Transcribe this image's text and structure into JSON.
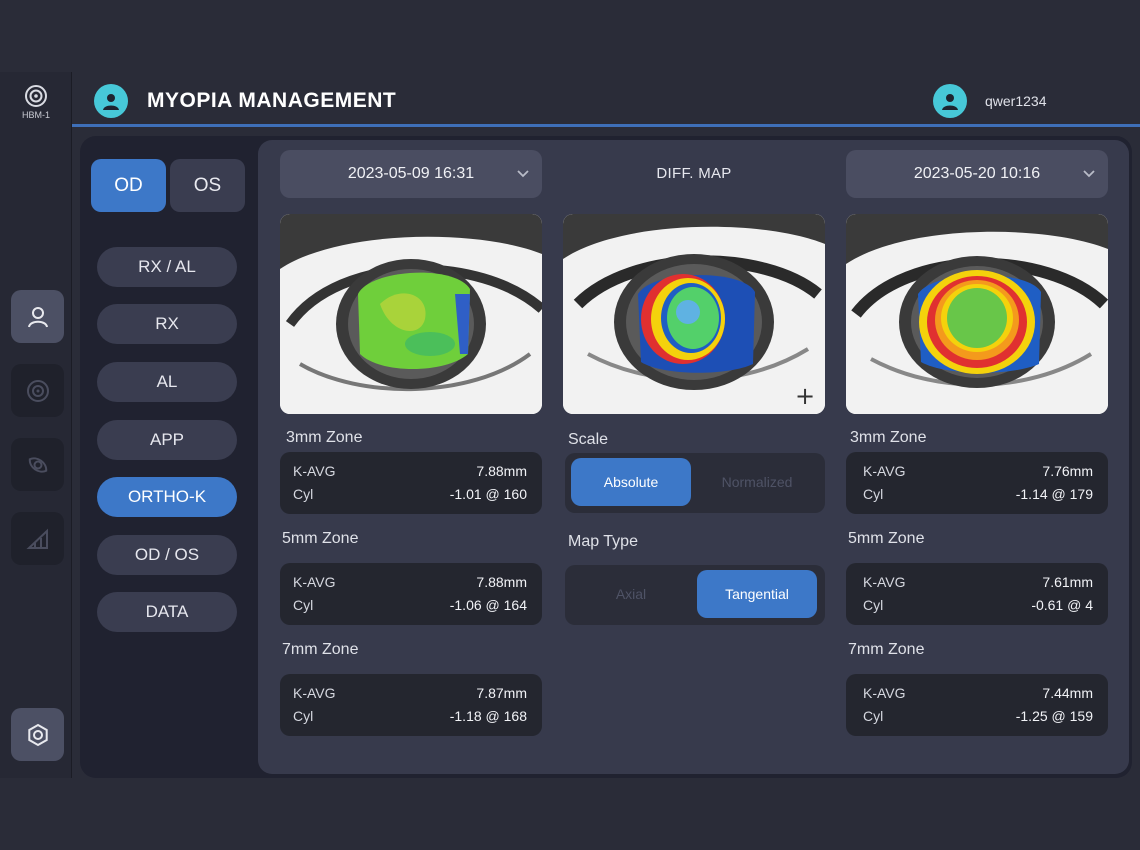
{
  "device": {
    "label": "HBM-1",
    "icon": "lens-icon"
  },
  "header": {
    "title": "MYOPIA MANAGEMENT",
    "username": "qwer1234"
  },
  "nav_rail": [
    {
      "name": "user-icon",
      "active": true
    },
    {
      "name": "target-icon",
      "active": false
    },
    {
      "name": "eye-scan-icon",
      "active": false
    },
    {
      "name": "chart-icon",
      "active": false
    },
    {
      "name": "settings-gear-icon",
      "active": false
    }
  ],
  "eye_toggle": {
    "od": "OD",
    "os": "OS",
    "selected": "OD"
  },
  "menu": [
    {
      "label": "RX / AL",
      "active": false
    },
    {
      "label": "RX",
      "active": false
    },
    {
      "label": "AL",
      "active": false
    },
    {
      "label": "APP",
      "active": false
    },
    {
      "label": "ORTHO-K",
      "active": true
    },
    {
      "label": "OD / OS",
      "active": false
    },
    {
      "label": "DATA",
      "active": false
    }
  ],
  "left_exam": {
    "date": "2023-05-09 16:31",
    "zones": [
      {
        "title": "3mm Zone",
        "kavg_label": "K-AVG",
        "kavg": "7.88mm",
        "cyl_label": "Cyl",
        "cyl": "-1.01 @ 160"
      },
      {
        "title": "5mm Zone",
        "kavg_label": "K-AVG",
        "kavg": "7.88mm",
        "cyl_label": "Cyl",
        "cyl": "-1.06 @ 164"
      },
      {
        "title": "7mm Zone",
        "kavg_label": "K-AVG",
        "kavg": "7.87mm",
        "cyl_label": "Cyl",
        "cyl": "-1.18 @ 168"
      }
    ]
  },
  "diff_map": {
    "label": "DIFF. MAP",
    "scale_title": "Scale",
    "scale_options": [
      "Absolute",
      "Normalized"
    ],
    "scale_selected": "Absolute",
    "map_type_title": "Map Type",
    "map_type_options": [
      "Axial",
      "Tangential"
    ],
    "map_type_selected": "Tangential"
  },
  "right_exam": {
    "date": "2023-05-20 10:16",
    "zones": [
      {
        "title": "3mm Zone",
        "kavg_label": "K-AVG",
        "kavg": "7.76mm",
        "cyl_label": "Cyl",
        "cyl": "-1.14 @ 179"
      },
      {
        "title": "5mm Zone",
        "kavg_label": "K-AVG",
        "kavg": "7.61mm",
        "cyl_label": "Cyl",
        "cyl": "-0.61 @ 4"
      },
      {
        "title": "7mm Zone",
        "kavg_label": "K-AVG",
        "kavg": "7.44mm",
        "cyl_label": "Cyl",
        "cyl": "-1.25 @ 159"
      }
    ]
  },
  "colors": {
    "accent": "#3d78c8",
    "avatar": "#47c8d8",
    "panel": "#373a4c",
    "background": "#2a2c38"
  }
}
